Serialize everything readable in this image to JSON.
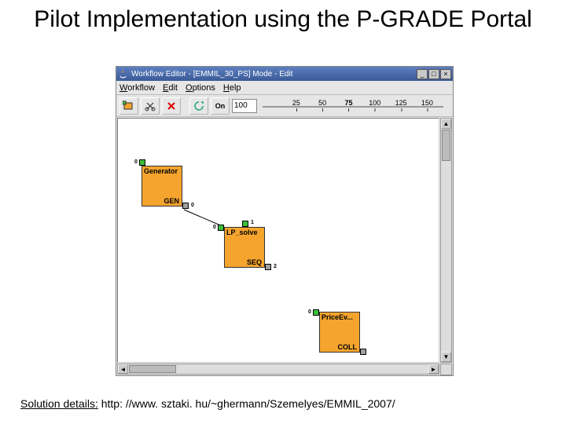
{
  "slide": {
    "title": "Pilot Implementation using the P-GRADE Portal",
    "footnote_label": "Solution details:",
    "footnote_url": "http: //www. sztaki. hu/~ghermann/Szemelyes/EMMIL_2007/"
  },
  "window": {
    "title": "Workflow Editor - [EMMIL_30_PS]  Mode - Edit",
    "controls": {
      "minimize": "_",
      "maximize": "□",
      "close": "×"
    }
  },
  "menu": {
    "items": [
      "Workflow",
      "Edit",
      "Options",
      "Help"
    ]
  },
  "toolbar": {
    "zoom_value": "100",
    "ticks": [
      {
        "val": "25",
        "pos": 18
      },
      {
        "val": "50",
        "pos": 32
      },
      {
        "val": "75",
        "pos": 46,
        "major": true
      },
      {
        "val": "100",
        "pos": 60
      },
      {
        "val": "125",
        "pos": 74
      },
      {
        "val": "150",
        "pos": 88
      }
    ]
  },
  "nodes": {
    "gen": {
      "label": "Generator",
      "sub": "GEN"
    },
    "lp": {
      "label": "LP_solve",
      "sub": "SEQ"
    },
    "pe": {
      "label": "PriceEv...",
      "sub": "COLL"
    }
  },
  "ports": {
    "p0a": "0",
    "p0b": "0",
    "p1b": "1",
    "p2c": "2",
    "p0c": "0"
  }
}
